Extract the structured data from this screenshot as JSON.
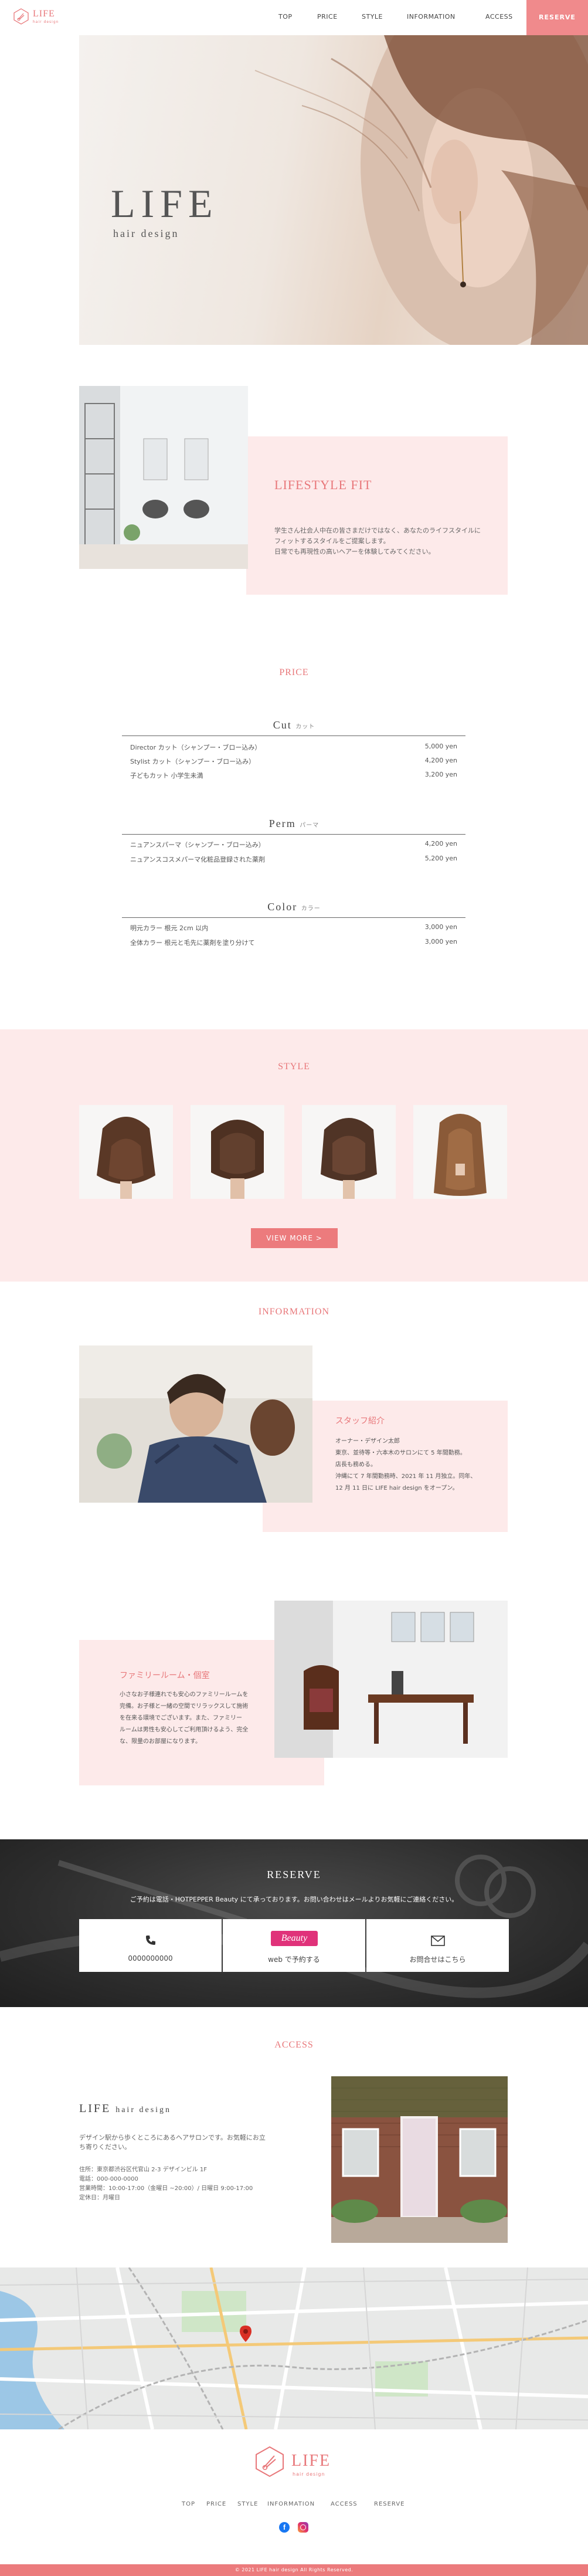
{
  "brand": {
    "name": "LIFE",
    "sub": "hair design",
    "accent": "#e8777a",
    "accent_bg": "#fdeaea"
  },
  "nav": {
    "items": [
      "TOP",
      "PRICE",
      "STYLE",
      "INFORMATION",
      "ACCESS"
    ],
    "reserve": "RESERVE"
  },
  "hero": {
    "title": "LIFE",
    "subtitle": "hair design"
  },
  "about": {
    "title": "LIFESTYLE FIT",
    "lines": [
      "学生さん社会人中在の皆さまだけではなく、あなたのライフスタイルに",
      "フィットするスタイルをご提案します。",
      "日常でも再現性の高いヘアーを体験してみてください。"
    ]
  },
  "price": {
    "title": "PRICE",
    "categories": [
      {
        "name": "Cut",
        "sub": "カット",
        "items": [
          {
            "name": "Director カット（シャンプー・ブロー込み）",
            "price": "5,000 yen"
          },
          {
            "name": "Stylist カット（シャンプー・ブロー込み）",
            "price": "4,200 yen"
          },
          {
            "name": "子どもカット 小学生未満",
            "price": "3,200 yen"
          }
        ]
      },
      {
        "name": "Perm",
        "sub": "パーマ",
        "items": [
          {
            "name": "ニュアンスパーマ（シャンプー・ブロー込み）",
            "price": "4,200 yen"
          },
          {
            "name": "ニュアンスコスメパーマ化粧品登録された薬剤",
            "price": "5,200 yen"
          }
        ]
      },
      {
        "name": "Color",
        "sub": "カラー",
        "items": [
          {
            "name": "明元カラー 根元 2cm 以内",
            "price": "3,000 yen"
          },
          {
            "name": "全体カラー 根元と毛先に薬剤を塗り分けて",
            "price": "3,000 yen"
          }
        ]
      }
    ]
  },
  "style": {
    "title": "STYLE",
    "view_more": "VIEW MORE  >"
  },
  "information": {
    "title": "INFORMATION",
    "staff": {
      "title": "スタッフ紹介",
      "lines": [
        "オーナー・デザイン太郎",
        "東京、並待等・六本木のサロンにて 5 年間勤務。",
        "店長も務める。",
        "沖縄にて 7 年間勤務時、2021 年 11 月独立。同年、",
        "12 月 11 日に LIFE hair design をオープン。"
      ]
    },
    "family": {
      "title": "ファミリールーム・個室",
      "lines": [
        "小さなお子様連れでも安心のファミリールームを",
        "完備。お子様と一緒の空間でリラックスして施術",
        "を在来る環境でございます。また、ファミリー",
        "ルームは男性も安心してご利用頂けるよう、完全",
        "な、限量のお部屋になります。"
      ]
    }
  },
  "reserve": {
    "title": "RESERVE",
    "text": "ご予約は電話・HOTPEPPER Beauty にて承っております。お問い合わせはメールよりお気軽にご連絡ください。",
    "phone": "0000000000",
    "web_brand": "Beauty",
    "web_label": "web で予約する",
    "mail_label": "お問合せはこちら"
  },
  "access": {
    "title": "ACCESS",
    "name": "LIFE",
    "name_sub": "hair design",
    "intro": [
      "デザイン駅から歩くところにあるヘアサロンです。お気軽にお立",
      "ち寄りください。"
    ],
    "details": [
      "住所：東京都渋谷区代官山 2-3 デザインビル 1F",
      "電話：000-000-0000",
      "営業時間：10:00-17:00（金曜日 ~20:00）/ 日曜日 9:00-17:00",
      "定休日：月曜日"
    ]
  },
  "footer": {
    "nav": [
      "TOP",
      "PRICE",
      "STYLE",
      "INFORMATION",
      "ACCESS",
      "RESERVE"
    ],
    "copyright": "© 2021 LIFE hair design All Rights Reserved."
  },
  "icons": {
    "logo": "scissors-hexagon-icon",
    "phone": "phone-icon",
    "mail": "mail-icon",
    "facebook": "facebook-icon",
    "instagram": "instagram-icon",
    "map_pin": "map-pin-icon"
  }
}
